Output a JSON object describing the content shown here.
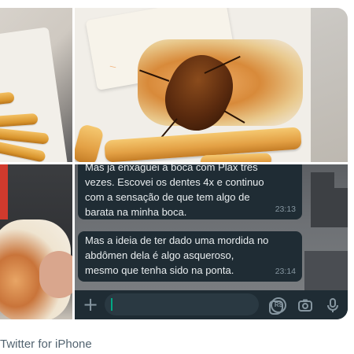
{
  "tweet": {
    "source": "Twitter for iPhone",
    "media": {
      "chat_screenshot": {
        "messages": [
          {
            "text_lines": [
              "Mas já enxaguei a boca com Plax três",
              "vezes. Escovei os dentes 4x e continuo",
              "com a sensação de que tem algo de",
              "barata na minha boca."
            ],
            "time": "23:13"
          },
          {
            "text_lines": [
              "Mas a ideia de ter dado uma mordida no",
              "abdômen dela é algo asqueroso,",
              "mesmo que tenha sido na ponta."
            ],
            "time": "23:14"
          }
        ],
        "input_icons": [
          "plus-icon",
          "sticker-icon",
          "payment-icon",
          "camera-icon",
          "microphone-icon"
        ],
        "payment_icon_label": "R$"
      },
      "wrapper_print": "\\"
    }
  },
  "colors": {
    "chat_bubble": "#1f2c34",
    "chat_text": "#e9edef",
    "chat_time": "#8696a0",
    "caret": "#00a884",
    "caption": "#536471"
  }
}
